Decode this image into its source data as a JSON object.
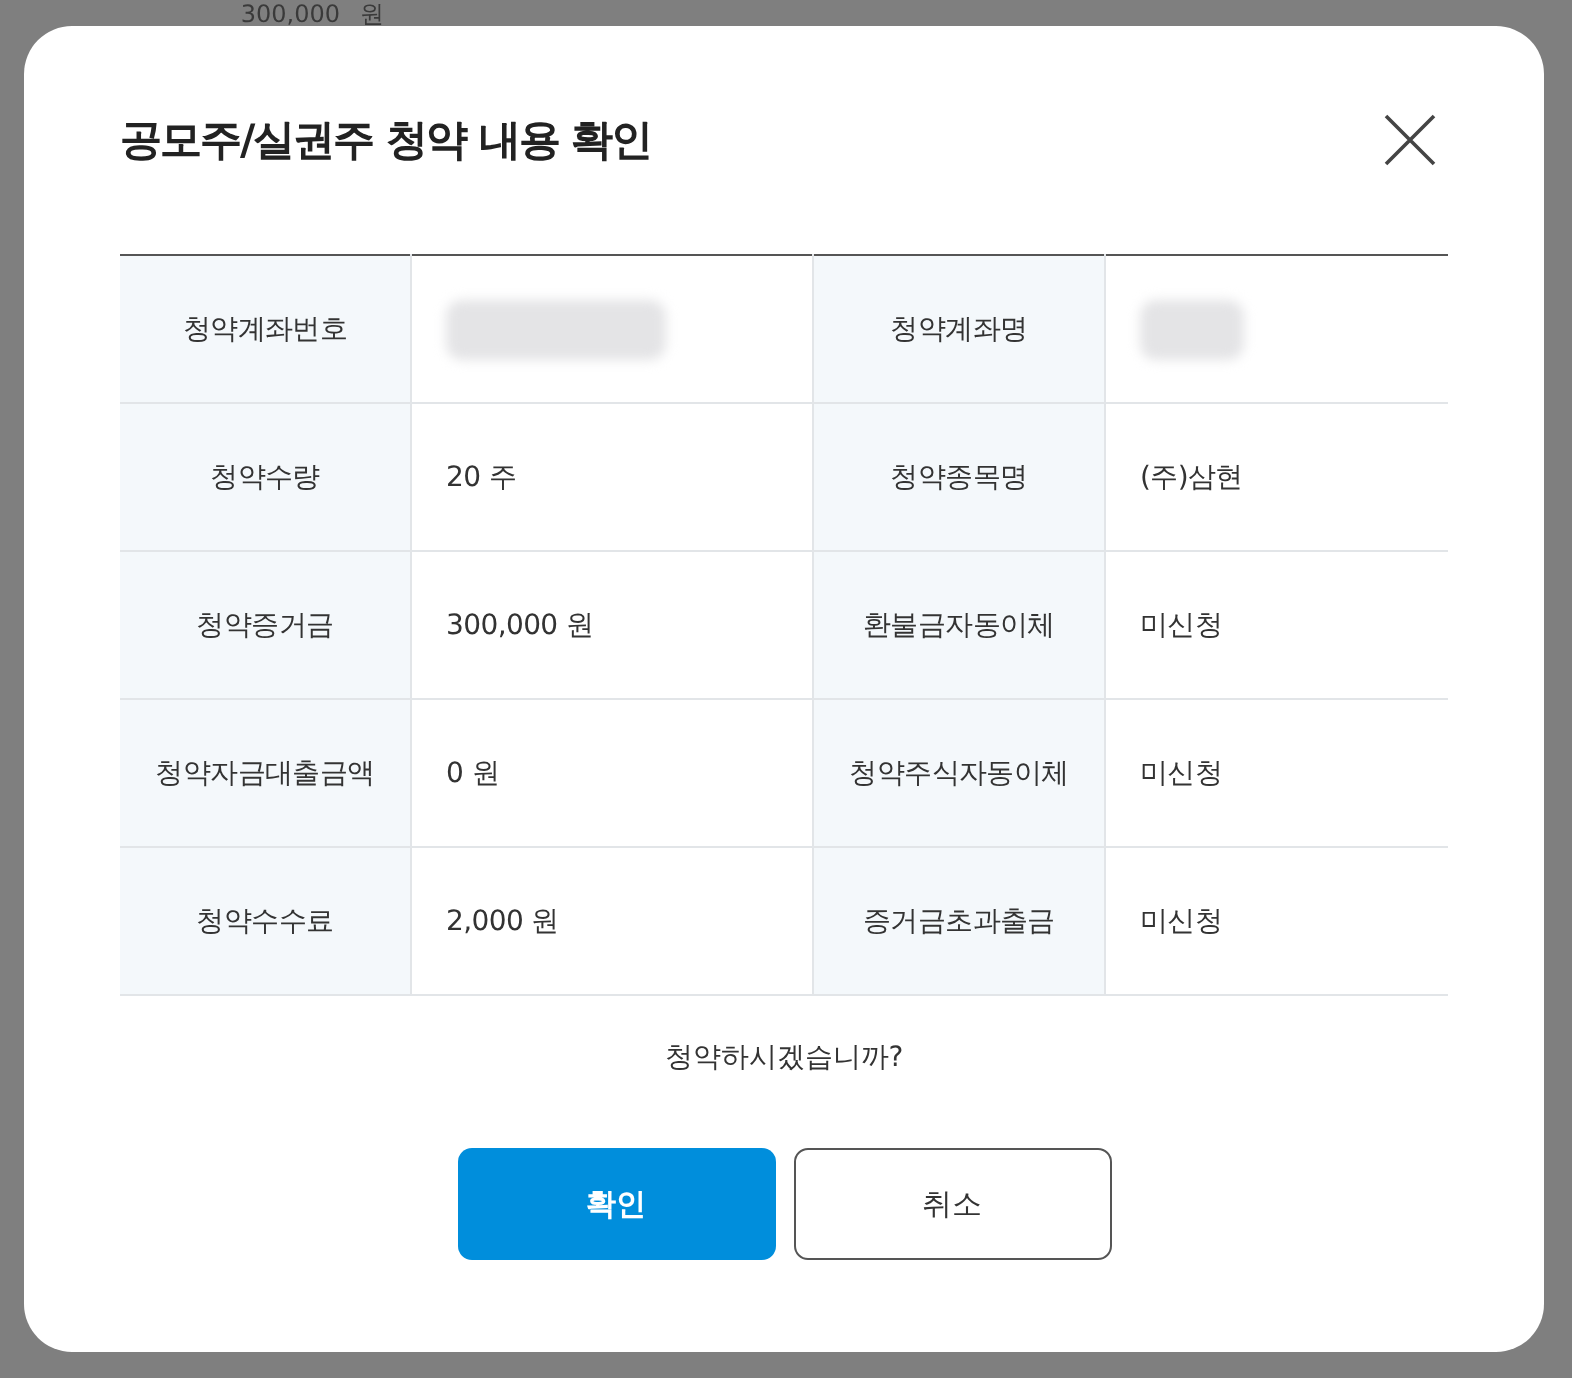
{
  "background": {
    "amount": "300,000",
    "unit": "원"
  },
  "dialog": {
    "title": "공모주/실권주 청약 내용 확인",
    "rows": [
      {
        "label_1": "청약계좌번호",
        "value_1": {
          "redacted": true
        },
        "label_2": "청약계좌명",
        "value_2": {
          "redacted": true
        }
      },
      {
        "label_1": "청약수량",
        "value_1": {
          "text": "20 주"
        },
        "label_2": "청약종목명",
        "value_2": {
          "text": "(주)삼현"
        }
      },
      {
        "label_1": "청약증거금",
        "value_1": {
          "text": "300,000 원"
        },
        "label_2": "환불금자동이체",
        "value_2": {
          "text": "미신청"
        }
      },
      {
        "label_1": "청약자금대출금액",
        "value_1": {
          "text": "0 원"
        },
        "label_2": "청약주식자동이체",
        "value_2": {
          "text": "미신청"
        }
      },
      {
        "label_1": "청약수수료",
        "value_1": {
          "text": "2,000 원"
        },
        "label_2": "증거금초과출금",
        "value_2": {
          "text": "미신청"
        }
      }
    ],
    "question": "청약하시겠습니까?",
    "buttons": [
      {
        "label": "확인",
        "kind": "primary"
      },
      {
        "label": "취소",
        "kind": "secondary"
      }
    ]
  }
}
